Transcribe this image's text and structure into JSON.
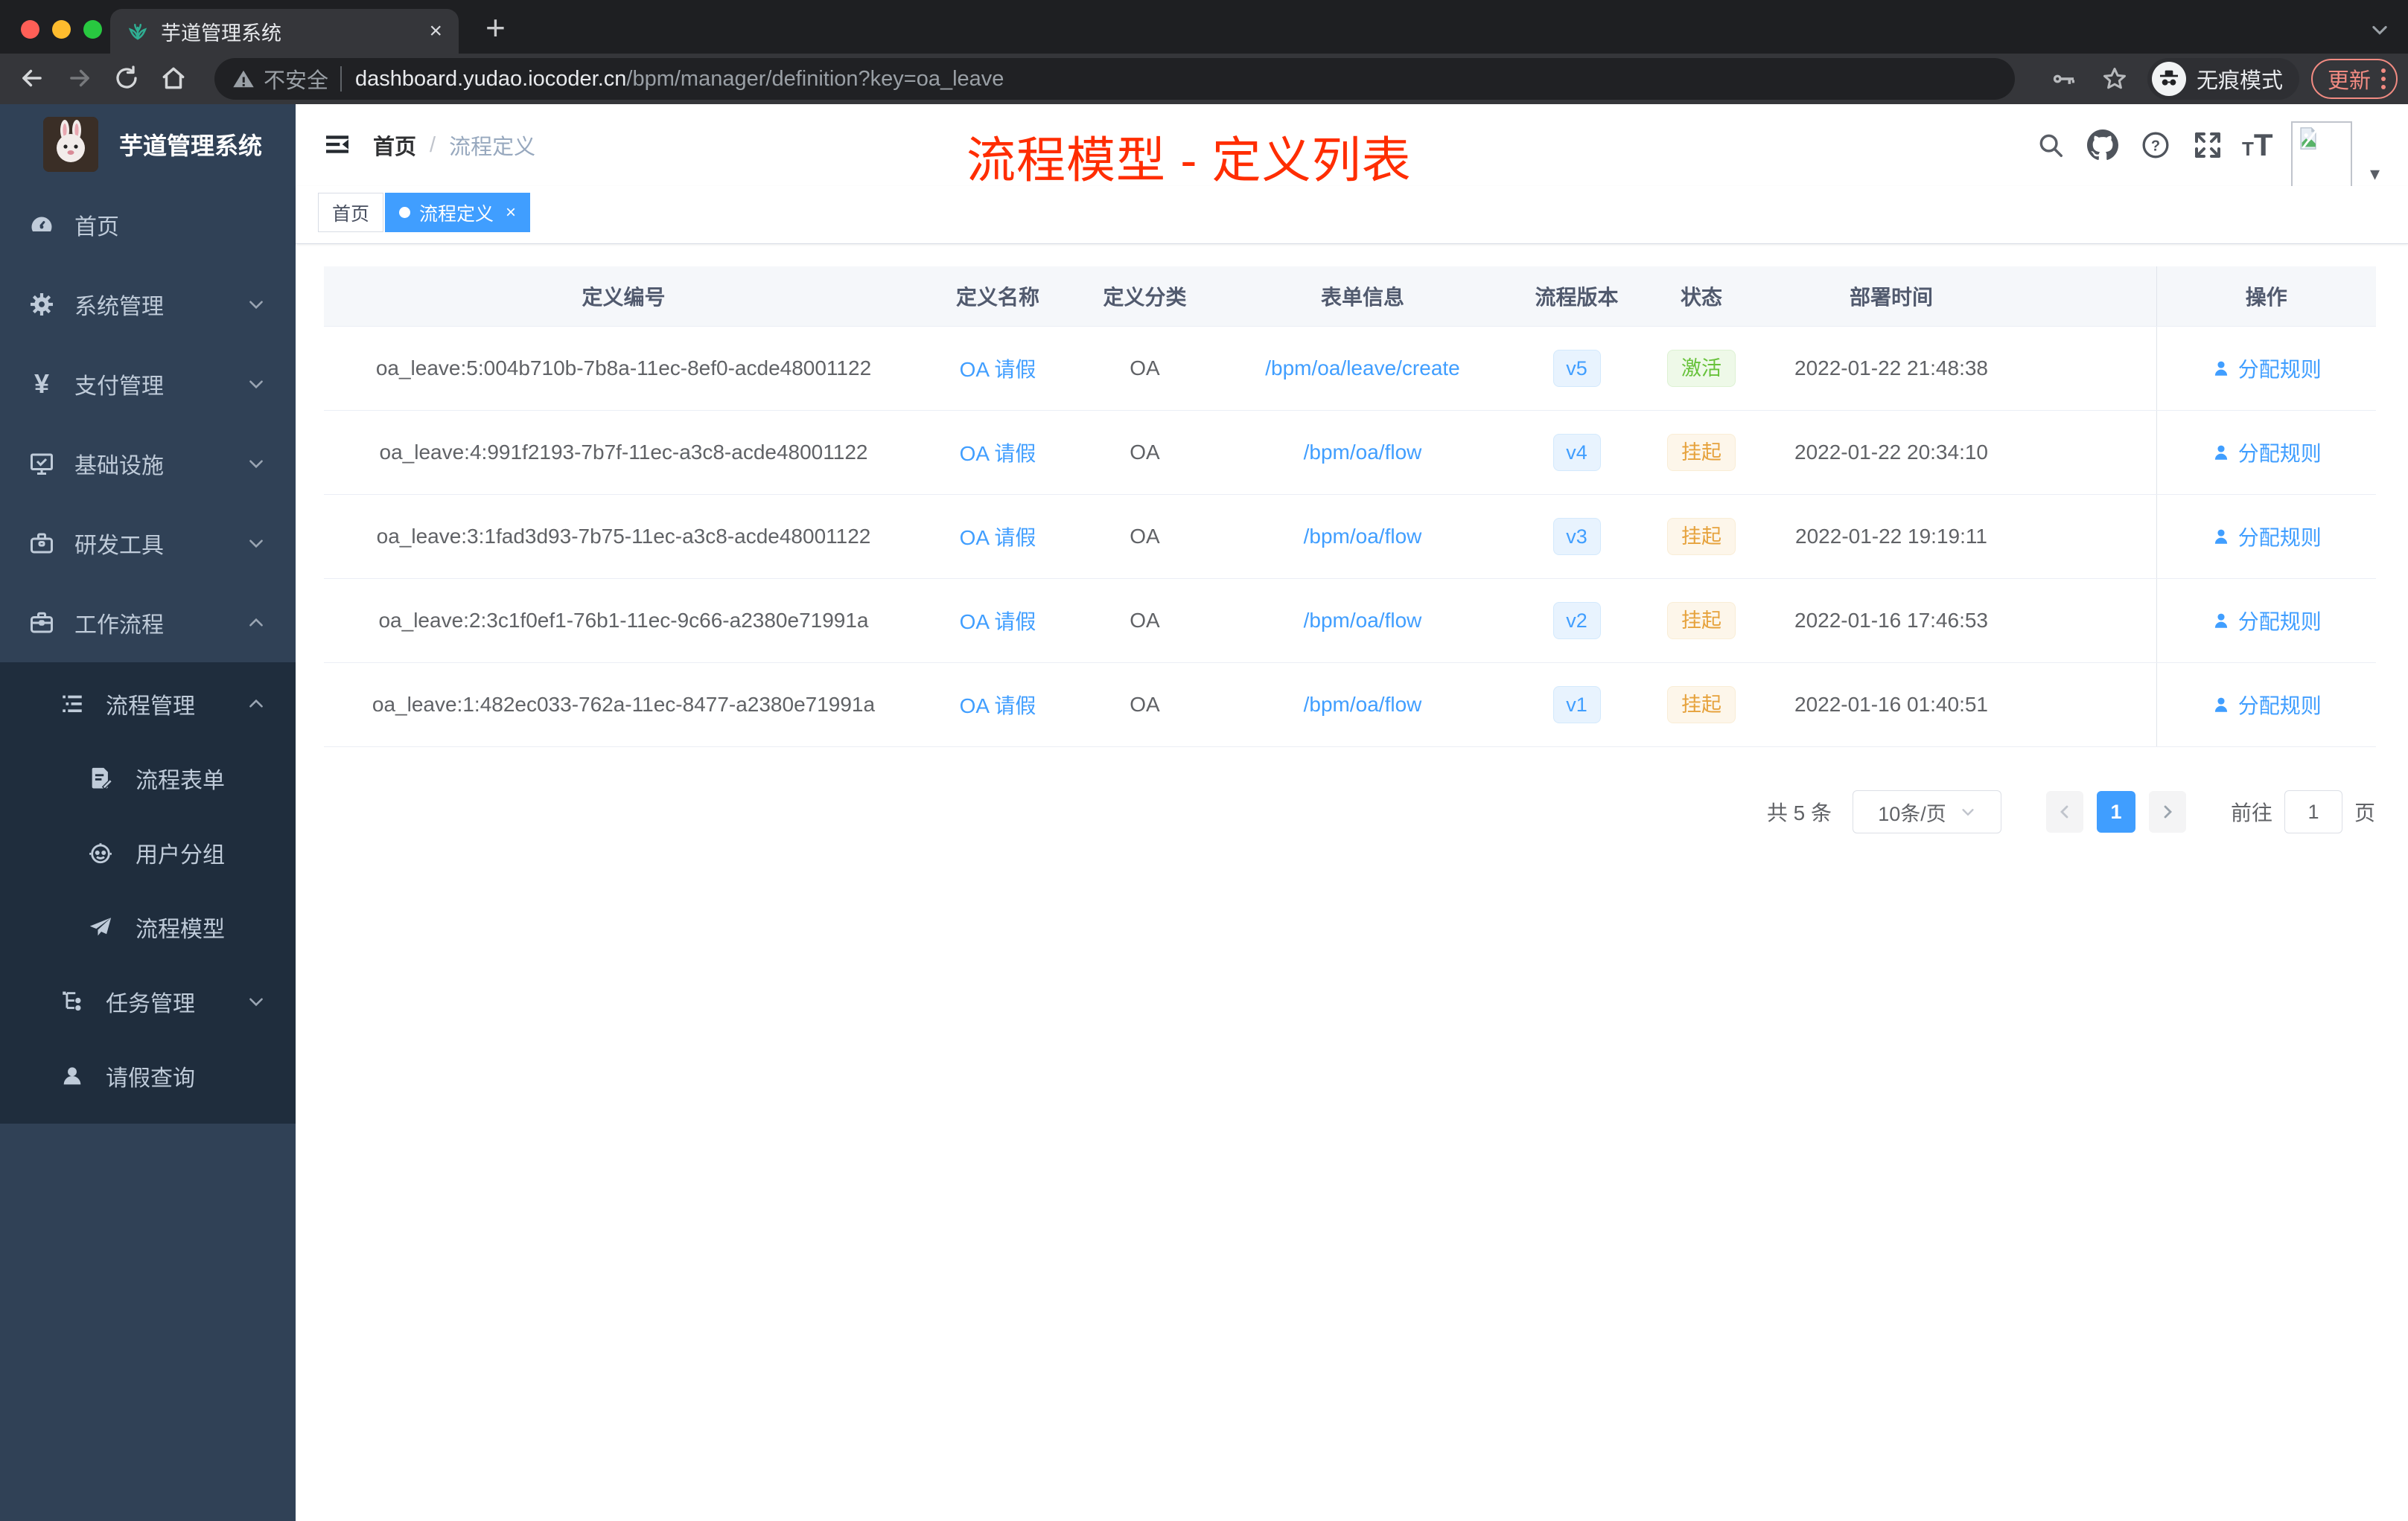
{
  "browser": {
    "tab": {
      "title": "芋道管理系统",
      "close": "×",
      "new_tab": "+"
    },
    "omnibox": {
      "security_label": "不安全",
      "url_domain": "dashboard.yudao.iocoder.cn",
      "url_path": "/bpm/manager/definition?key=oa_leave"
    },
    "incognito_label": "无痕模式",
    "update_label": "更新"
  },
  "sidebar": {
    "app_title": "芋道管理系统",
    "menu": [
      {
        "label": "首页"
      },
      {
        "label": "系统管理"
      },
      {
        "label": "支付管理"
      },
      {
        "label": "基础设施"
      },
      {
        "label": "研发工具"
      },
      {
        "label": "工作流程"
      }
    ],
    "submenu": [
      {
        "label": "流程管理"
      },
      {
        "label": "流程表单"
      },
      {
        "label": "用户分组"
      },
      {
        "label": "流程模型"
      },
      {
        "label": "任务管理"
      },
      {
        "label": "请假查询"
      }
    ]
  },
  "header": {
    "breadcrumb": {
      "first": "首页",
      "separator": "/",
      "current": "流程定义"
    },
    "annotation": "流程模型 - 定义列表"
  },
  "tags": [
    {
      "label": "首页"
    },
    {
      "label": "流程定义",
      "close": "×"
    }
  ],
  "table": {
    "columns": [
      "定义编号",
      "定义名称",
      "定义分类",
      "表单信息",
      "流程版本",
      "状态",
      "部署时间",
      "操作"
    ],
    "rows": [
      {
        "id": "oa_leave:5:004b710b-7b8a-11ec-8ef0-acde48001122",
        "name": "OA 请假",
        "category": "OA",
        "form": "/bpm/oa/leave/create",
        "version": "v5",
        "status": "激活",
        "time": "2022-01-22 21:48:38",
        "action": "分配规则"
      },
      {
        "id": "oa_leave:4:991f2193-7b7f-11ec-a3c8-acde48001122",
        "name": "OA 请假",
        "category": "OA",
        "form": "/bpm/oa/flow",
        "version": "v4",
        "status": "挂起",
        "time": "2022-01-22 20:34:10",
        "action": "分配规则"
      },
      {
        "id": "oa_leave:3:1fad3d93-7b75-11ec-a3c8-acde48001122",
        "name": "OA 请假",
        "category": "OA",
        "form": "/bpm/oa/flow",
        "version": "v3",
        "status": "挂起",
        "time": "2022-01-22 19:19:11",
        "action": "分配规则"
      },
      {
        "id": "oa_leave:2:3c1f0ef1-76b1-11ec-9c66-a2380e71991a",
        "name": "OA 请假",
        "category": "OA",
        "form": "/bpm/oa/flow",
        "version": "v2",
        "status": "挂起",
        "time": "2022-01-16 17:46:53",
        "action": "分配规则"
      },
      {
        "id": "oa_leave:1:482ec033-762a-11ec-8477-a2380e71991a",
        "name": "OA 请假",
        "category": "OA",
        "form": "/bpm/oa/flow",
        "version": "v1",
        "status": "挂起",
        "time": "2022-01-16 01:40:51",
        "action": "分配规则"
      }
    ]
  },
  "pagination": {
    "total": "共 5 条",
    "page_size": "10条/页",
    "page": "1",
    "goto_label": "前往",
    "goto_value": "1",
    "unit": "页"
  },
  "icons": {
    "font_size_small": "T",
    "font_size_large": "T",
    "question_mark": "?",
    "yen": "¥",
    "caret_down": "▾"
  },
  "colors": {
    "accent_blue": "#409eff",
    "success_green": "#67c23a",
    "warning_orange": "#e6a23c",
    "annotation_red": "#ff2d00",
    "sidebar_bg": "#304156",
    "submenu_bg": "#1f2d3d"
  }
}
